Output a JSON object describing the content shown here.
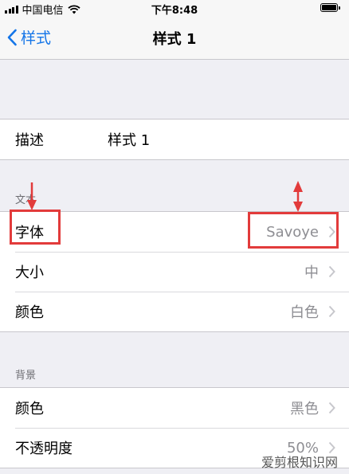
{
  "status_bar": {
    "carrier": "中国电信",
    "time": "下午8:48"
  },
  "nav": {
    "back_label": "样式",
    "title": "样式 1"
  },
  "description_row": {
    "label": "描述",
    "value": "样式 1"
  },
  "text_section": {
    "header": "文本",
    "rows": [
      {
        "label": "字体",
        "value": "Savoye"
      },
      {
        "label": "大小",
        "value": "中"
      },
      {
        "label": "颜色",
        "value": "白色"
      }
    ]
  },
  "background_section": {
    "header": "背景",
    "rows": [
      {
        "label": "颜色",
        "value": "黑色"
      },
      {
        "label": "不透明度",
        "value": "50%"
      }
    ]
  },
  "watermark": {
    "text": "爱剪根知识网"
  },
  "colors": {
    "accent": "#1475e8",
    "annotation": "#e23b3b",
    "secondary_text": "#8e8e93"
  }
}
